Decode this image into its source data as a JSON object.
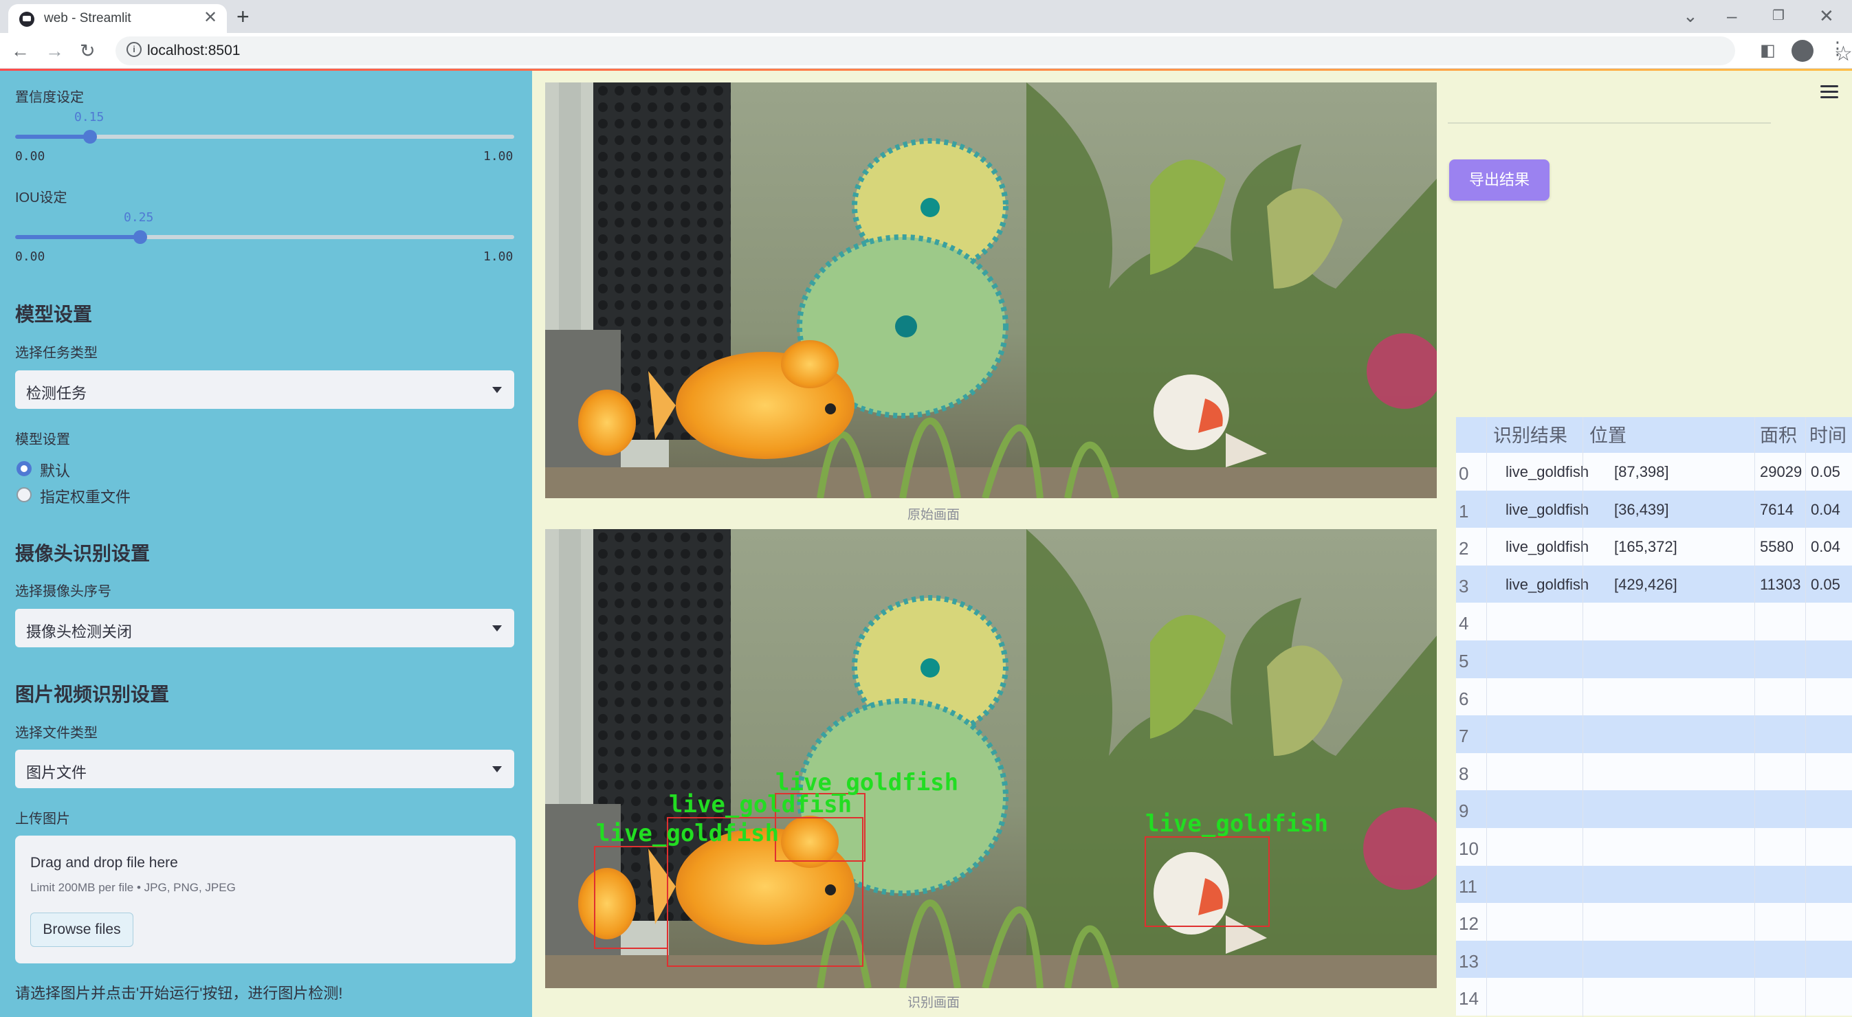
{
  "browser": {
    "tab_title": "web - Streamlit",
    "url": "localhost:8501"
  },
  "sidebar": {
    "confidence": {
      "label": "置信度设定",
      "value": "0.15",
      "fraction": 0.15,
      "min": "0.00",
      "max": "1.00"
    },
    "iou": {
      "label": "IOU设定",
      "value": "0.25",
      "fraction": 0.25,
      "min": "0.00",
      "max": "1.00"
    },
    "model_section": {
      "title": "模型设置",
      "task_label": "选择任务类型",
      "task_value": "检测任务",
      "model_label": "模型设置",
      "radio_options": [
        "默认",
        "指定权重文件"
      ],
      "radio_selected": 0
    },
    "camera_section": {
      "title": "摄像头识别设置",
      "camera_label": "选择摄像头序号",
      "camera_value": "摄像头检测关闭"
    },
    "media_section": {
      "title": "图片视频识别设置",
      "filetype_label": "选择文件类型",
      "filetype_value": "图片文件",
      "upload_label": "上传图片",
      "drop_text": "Drag and drop file here",
      "limit_text": "Limit 200MB per file • JPG, PNG, JPEG",
      "browse_label": "Browse files"
    },
    "hint": "请选择图片并点击'开始运行'按钮，进行图片检测!"
  },
  "main": {
    "original_caption": "原始画面",
    "result_caption": "识别画面",
    "export_label": "导出结果",
    "detections": [
      {
        "label": "live_goldfish"
      },
      {
        "label": "live_goldfish"
      },
      {
        "label": "live_goldfish"
      },
      {
        "label": "live_goldfish"
      }
    ]
  },
  "table": {
    "columns": [
      "识别结果",
      "位置",
      "面积",
      "时间"
    ],
    "rows": [
      {
        "index": "0",
        "result": "live_goldfish",
        "position": "[87,398]",
        "area": "29029",
        "time": "0.05"
      },
      {
        "index": "1",
        "result": "live_goldfish",
        "position": "[36,439]",
        "area": "7614",
        "time": "0.04"
      },
      {
        "index": "2",
        "result": "live_goldfish",
        "position": "[165,372]",
        "area": "5580",
        "time": "0.04"
      },
      {
        "index": "3",
        "result": "live_goldfish",
        "position": "[429,426]",
        "area": "11303",
        "time": "0.05"
      },
      {
        "index": "4"
      },
      {
        "index": "5"
      },
      {
        "index": "6"
      },
      {
        "index": "7"
      },
      {
        "index": "8"
      },
      {
        "index": "9"
      },
      {
        "index": "10"
      },
      {
        "index": "11"
      },
      {
        "index": "12"
      },
      {
        "index": "13"
      },
      {
        "index": "14"
      }
    ]
  },
  "colors": {
    "sidebar_bg": "#6dc2d9",
    "main_bg": "#f2f5d8",
    "accent": "#4f79d3",
    "export_button": "#9b82f0",
    "detection_box": "#e03030",
    "detection_label": "#22dd22"
  }
}
